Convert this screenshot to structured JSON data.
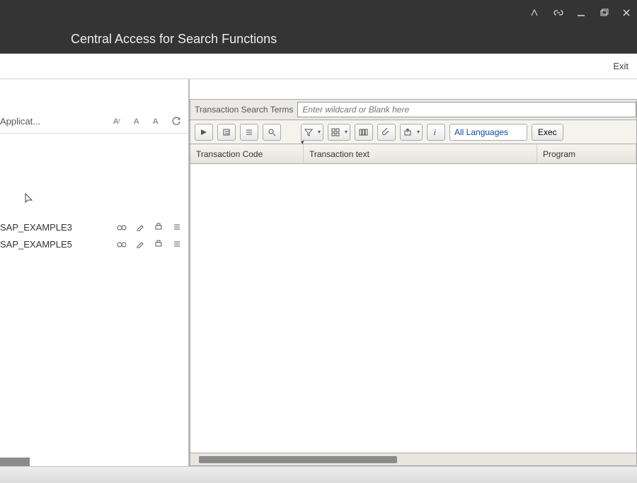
{
  "titlebar": {
    "icons": [
      "link-icon",
      "minimize-icon",
      "restore-icon",
      "close-icon"
    ]
  },
  "header": {
    "title": "Central Access for Search Functions"
  },
  "actionbar": {
    "exit": "Exit"
  },
  "left": {
    "filter_label": "Applicat...",
    "items": [
      {
        "name": "SAP_EXAMPLE3"
      },
      {
        "name": "SAP_EXAMPLE5"
      }
    ]
  },
  "search": {
    "label": "Transaction Search Terms",
    "placeholder": "Enter wildcard or Blank here"
  },
  "toolbar": {
    "language": "All Languages",
    "execute": "Exec"
  },
  "grid": {
    "columns": [
      "Transaction Code",
      "Transaction text",
      "Program"
    ]
  }
}
